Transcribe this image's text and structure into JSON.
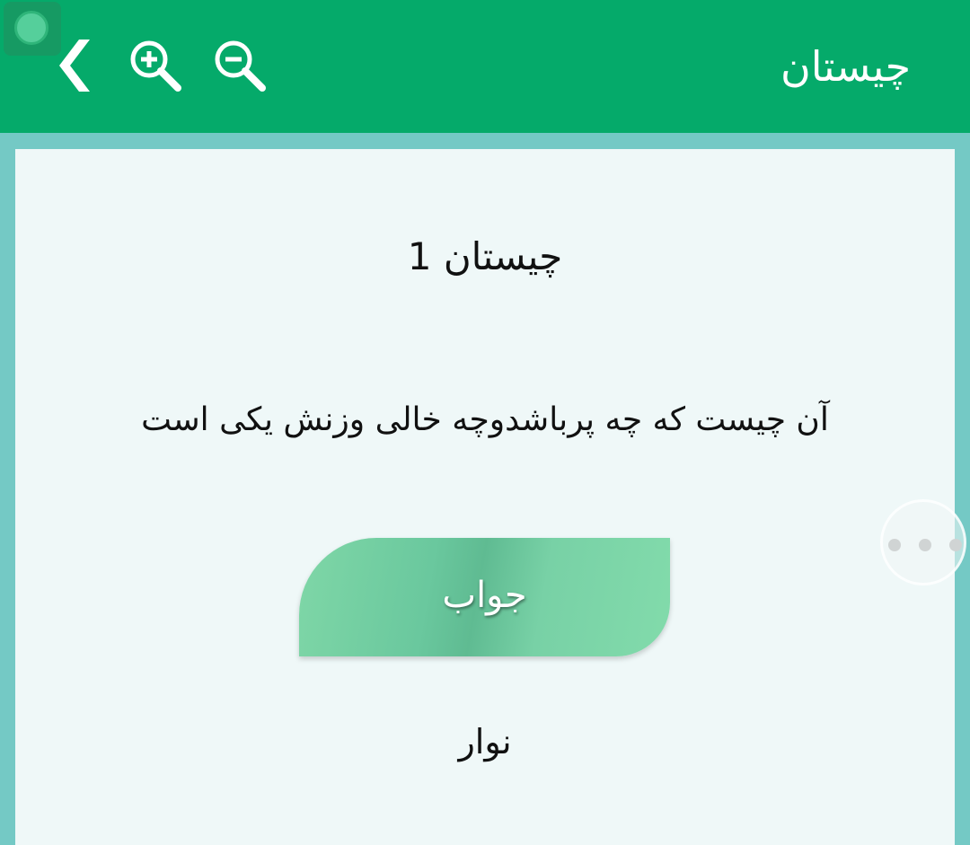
{
  "appbar": {
    "title": "چیستان",
    "background": "#05aa6a",
    "back_icon": "chevron-left-icon",
    "zoom_in_icon": "zoom-in-icon",
    "zoom_out_icon": "zoom-out-icon"
  },
  "content": {
    "riddle_title": "چیستان 1",
    "question": "آن چیست که چه پرباشدوچه خالی وزنش یکی است",
    "answer_button_label": "جواب",
    "answer": "نوار"
  },
  "colors": {
    "page_background": "#74c9c5",
    "card_background": "#eff8f8",
    "answer_button": "#6ac89e"
  }
}
